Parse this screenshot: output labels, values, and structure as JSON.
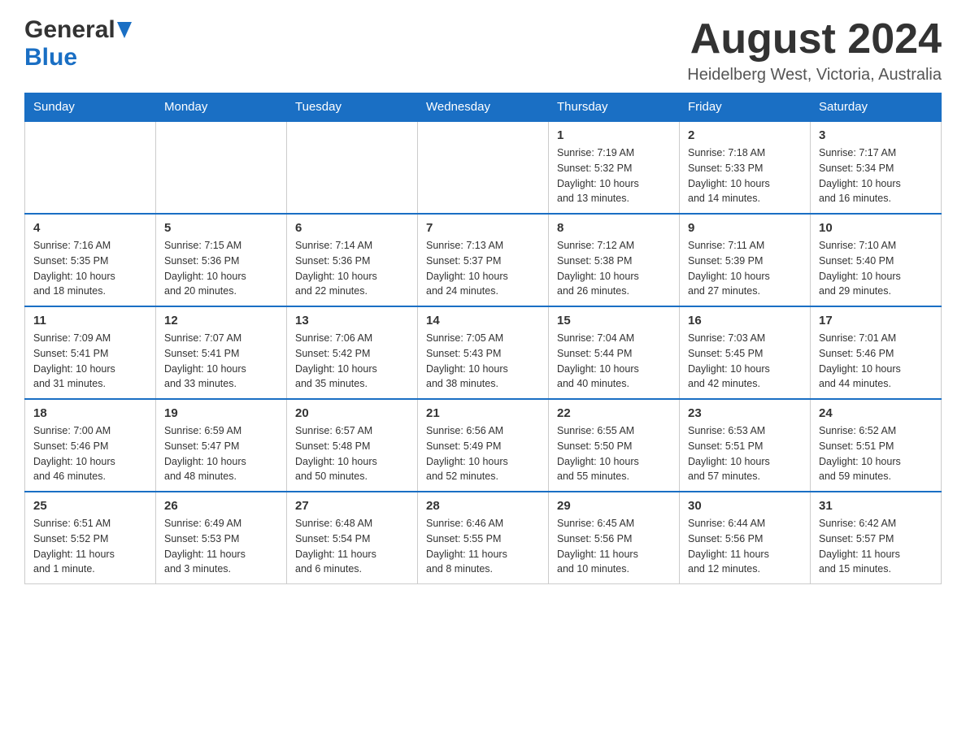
{
  "header": {
    "logo_general": "General",
    "logo_blue": "Blue",
    "month_title": "August 2024",
    "location": "Heidelberg West, Victoria, Australia"
  },
  "days_of_week": [
    "Sunday",
    "Monday",
    "Tuesday",
    "Wednesday",
    "Thursday",
    "Friday",
    "Saturday"
  ],
  "weeks": [
    {
      "days": [
        {
          "number": "",
          "info": ""
        },
        {
          "number": "",
          "info": ""
        },
        {
          "number": "",
          "info": ""
        },
        {
          "number": "",
          "info": ""
        },
        {
          "number": "1",
          "info": "Sunrise: 7:19 AM\nSunset: 5:32 PM\nDaylight: 10 hours\nand 13 minutes."
        },
        {
          "number": "2",
          "info": "Sunrise: 7:18 AM\nSunset: 5:33 PM\nDaylight: 10 hours\nand 14 minutes."
        },
        {
          "number": "3",
          "info": "Sunrise: 7:17 AM\nSunset: 5:34 PM\nDaylight: 10 hours\nand 16 minutes."
        }
      ]
    },
    {
      "days": [
        {
          "number": "4",
          "info": "Sunrise: 7:16 AM\nSunset: 5:35 PM\nDaylight: 10 hours\nand 18 minutes."
        },
        {
          "number": "5",
          "info": "Sunrise: 7:15 AM\nSunset: 5:36 PM\nDaylight: 10 hours\nand 20 minutes."
        },
        {
          "number": "6",
          "info": "Sunrise: 7:14 AM\nSunset: 5:36 PM\nDaylight: 10 hours\nand 22 minutes."
        },
        {
          "number": "7",
          "info": "Sunrise: 7:13 AM\nSunset: 5:37 PM\nDaylight: 10 hours\nand 24 minutes."
        },
        {
          "number": "8",
          "info": "Sunrise: 7:12 AM\nSunset: 5:38 PM\nDaylight: 10 hours\nand 26 minutes."
        },
        {
          "number": "9",
          "info": "Sunrise: 7:11 AM\nSunset: 5:39 PM\nDaylight: 10 hours\nand 27 minutes."
        },
        {
          "number": "10",
          "info": "Sunrise: 7:10 AM\nSunset: 5:40 PM\nDaylight: 10 hours\nand 29 minutes."
        }
      ]
    },
    {
      "days": [
        {
          "number": "11",
          "info": "Sunrise: 7:09 AM\nSunset: 5:41 PM\nDaylight: 10 hours\nand 31 minutes."
        },
        {
          "number": "12",
          "info": "Sunrise: 7:07 AM\nSunset: 5:41 PM\nDaylight: 10 hours\nand 33 minutes."
        },
        {
          "number": "13",
          "info": "Sunrise: 7:06 AM\nSunset: 5:42 PM\nDaylight: 10 hours\nand 35 minutes."
        },
        {
          "number": "14",
          "info": "Sunrise: 7:05 AM\nSunset: 5:43 PM\nDaylight: 10 hours\nand 38 minutes."
        },
        {
          "number": "15",
          "info": "Sunrise: 7:04 AM\nSunset: 5:44 PM\nDaylight: 10 hours\nand 40 minutes."
        },
        {
          "number": "16",
          "info": "Sunrise: 7:03 AM\nSunset: 5:45 PM\nDaylight: 10 hours\nand 42 minutes."
        },
        {
          "number": "17",
          "info": "Sunrise: 7:01 AM\nSunset: 5:46 PM\nDaylight: 10 hours\nand 44 minutes."
        }
      ]
    },
    {
      "days": [
        {
          "number": "18",
          "info": "Sunrise: 7:00 AM\nSunset: 5:46 PM\nDaylight: 10 hours\nand 46 minutes."
        },
        {
          "number": "19",
          "info": "Sunrise: 6:59 AM\nSunset: 5:47 PM\nDaylight: 10 hours\nand 48 minutes."
        },
        {
          "number": "20",
          "info": "Sunrise: 6:57 AM\nSunset: 5:48 PM\nDaylight: 10 hours\nand 50 minutes."
        },
        {
          "number": "21",
          "info": "Sunrise: 6:56 AM\nSunset: 5:49 PM\nDaylight: 10 hours\nand 52 minutes."
        },
        {
          "number": "22",
          "info": "Sunrise: 6:55 AM\nSunset: 5:50 PM\nDaylight: 10 hours\nand 55 minutes."
        },
        {
          "number": "23",
          "info": "Sunrise: 6:53 AM\nSunset: 5:51 PM\nDaylight: 10 hours\nand 57 minutes."
        },
        {
          "number": "24",
          "info": "Sunrise: 6:52 AM\nSunset: 5:51 PM\nDaylight: 10 hours\nand 59 minutes."
        }
      ]
    },
    {
      "days": [
        {
          "number": "25",
          "info": "Sunrise: 6:51 AM\nSunset: 5:52 PM\nDaylight: 11 hours\nand 1 minute."
        },
        {
          "number": "26",
          "info": "Sunrise: 6:49 AM\nSunset: 5:53 PM\nDaylight: 11 hours\nand 3 minutes."
        },
        {
          "number": "27",
          "info": "Sunrise: 6:48 AM\nSunset: 5:54 PM\nDaylight: 11 hours\nand 6 minutes."
        },
        {
          "number": "28",
          "info": "Sunrise: 6:46 AM\nSunset: 5:55 PM\nDaylight: 11 hours\nand 8 minutes."
        },
        {
          "number": "29",
          "info": "Sunrise: 6:45 AM\nSunset: 5:56 PM\nDaylight: 11 hours\nand 10 minutes."
        },
        {
          "number": "30",
          "info": "Sunrise: 6:44 AM\nSunset: 5:56 PM\nDaylight: 11 hours\nand 12 minutes."
        },
        {
          "number": "31",
          "info": "Sunrise: 6:42 AM\nSunset: 5:57 PM\nDaylight: 11 hours\nand 15 minutes."
        }
      ]
    }
  ]
}
